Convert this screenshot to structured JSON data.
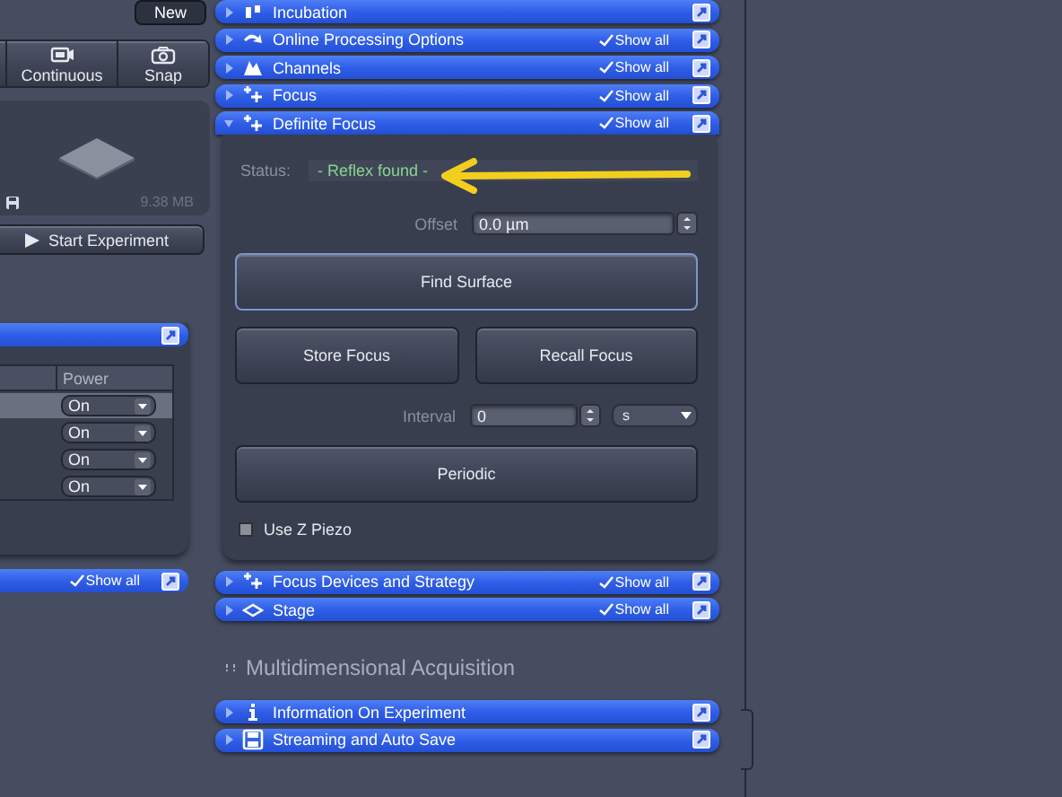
{
  "left_panel": {
    "new_button": "New",
    "acquire_buttons": [
      {
        "kind": "continuous",
        "label": "Continuous"
      },
      {
        "kind": "snap",
        "label": "Snap"
      }
    ],
    "preview": {
      "size": "9.38 MB"
    },
    "start_button": "Start Experiment",
    "light_table": {
      "columns": [
        "Power"
      ],
      "rows": [
        {
          "power": "On",
          "selected": true
        },
        {
          "power": "On",
          "selected": false
        },
        {
          "power": "On",
          "selected": false
        },
        {
          "power": "On",
          "selected": false
        }
      ]
    },
    "bottom_bar": {
      "show_all": {
        "label": "Show all",
        "checked": true
      }
    }
  },
  "tool_groups": [
    {
      "kind": "incubation",
      "title": "Incubation",
      "expanded": false
    },
    {
      "kind": "processing",
      "title": "Online Processing Options",
      "expanded": false,
      "show_all": {
        "label": "Show all",
        "checked": true
      }
    },
    {
      "kind": "channels",
      "title": "Channels",
      "expanded": false,
      "show_all": {
        "label": "Show all",
        "checked": true
      }
    },
    {
      "kind": "focus",
      "title": "Focus",
      "expanded": false,
      "show_all": {
        "label": "Show all",
        "checked": true
      }
    },
    {
      "kind": "focus",
      "title": "Definite Focus",
      "expanded": true,
      "show_all": {
        "label": "Show all",
        "checked": true
      },
      "panel": {
        "status_label": "Status:",
        "status": "- Reflex found -",
        "offset_label": "Offset",
        "offset": "0.0 µm",
        "find_surface": "Find Surface",
        "store_focus": "Store Focus",
        "recall_focus": "Recall Focus",
        "interval_label": "Interval",
        "interval": "0",
        "interval_unit": "s",
        "periodic": "Periodic",
        "use_z_piezo": {
          "label": "Use Z Piezo",
          "checked": false
        }
      }
    },
    {
      "kind": "focus",
      "title": "Focus Devices and Strategy",
      "expanded": false,
      "show_all": {
        "label": "Show all",
        "checked": true
      }
    },
    {
      "kind": "stage",
      "title": "Stage",
      "expanded": false,
      "show_all": {
        "label": "Show all",
        "checked": true
      }
    }
  ],
  "section": {
    "title": "Multidimensional Acquisition",
    "groups": [
      {
        "kind": "info",
        "title": "Information On Experiment",
        "expanded": false
      },
      {
        "kind": "save",
        "title": "Streaming and Auto Save",
        "expanded": false
      }
    ]
  }
}
